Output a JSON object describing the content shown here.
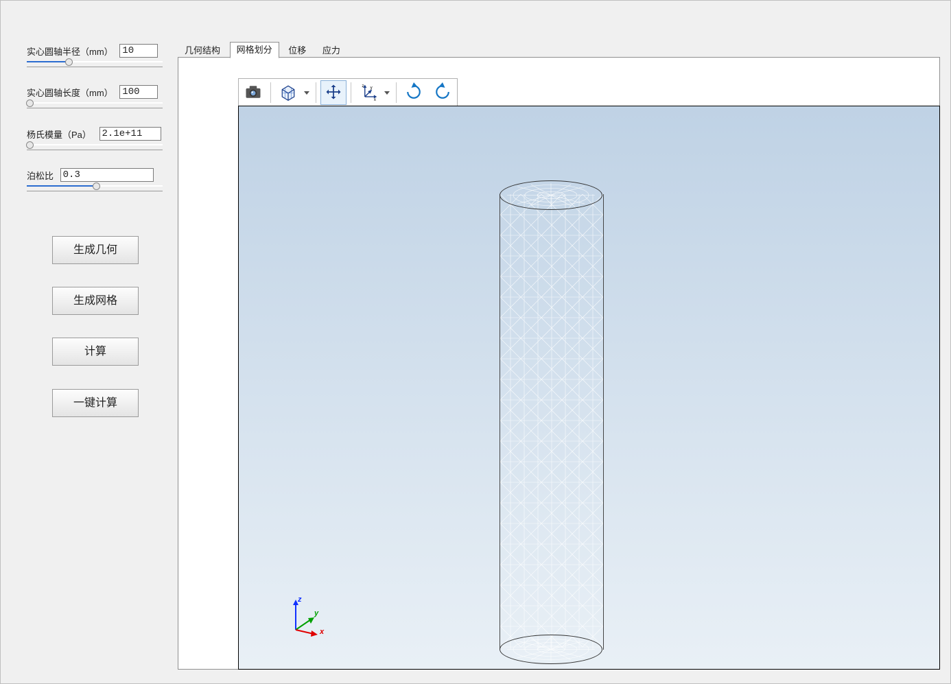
{
  "params": {
    "radius": {
      "label": "实心圆轴半径（mm）",
      "value": "10",
      "slider_pct": 31
    },
    "length": {
      "label": "实心圆轴长度（mm）",
      "value": "100",
      "slider_pct": 2
    },
    "young": {
      "label": "杨氏模量（Pa）",
      "value": "2.1e+11",
      "slider_pct": 2
    },
    "poisson": {
      "label": "泊松比",
      "value": "0.3",
      "slider_pct": 51
    }
  },
  "buttons": {
    "gen_geom": "生成几何",
    "gen_mesh": "生成网格",
    "compute": "计算",
    "one_click": "一键计算"
  },
  "tabs": {
    "geom": "几何结构",
    "mesh": "网格划分",
    "disp": "位移",
    "stress": "应力",
    "active": "mesh"
  },
  "toolbar": {
    "snapshot": "camera-icon",
    "render": "cube-icon",
    "pan": "move-icon",
    "orient": "axes-icon",
    "rotate_cw": "rotate-cw-icon",
    "rotate_ccw": "rotate-ccw-icon"
  },
  "axes": {
    "x": "x",
    "y": "y",
    "z": "z"
  }
}
